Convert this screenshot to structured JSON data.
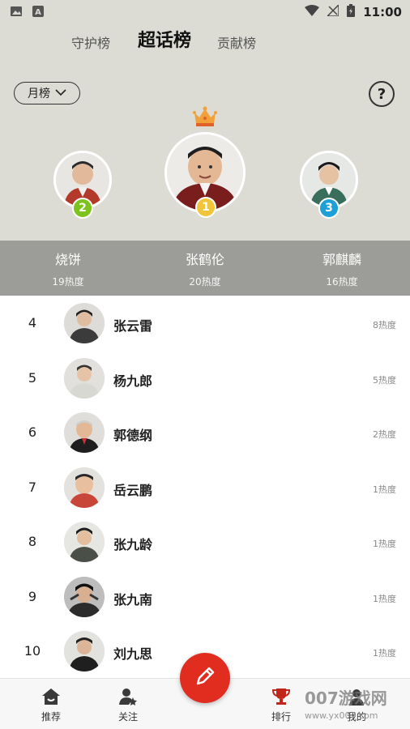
{
  "status_bar": {
    "time": "11:00"
  },
  "tabs": [
    {
      "label": "守护榜"
    },
    {
      "label": "超话榜"
    },
    {
      "label": "贡献榜"
    }
  ],
  "filter": {
    "label": "月榜"
  },
  "help": {
    "label": "?"
  },
  "podium": [
    {
      "rank": "2",
      "name": "烧饼",
      "heat": "19热度"
    },
    {
      "rank": "1",
      "name": "张鹤伦",
      "heat": "20热度"
    },
    {
      "rank": "3",
      "name": "郭麒麟",
      "heat": "16热度"
    }
  ],
  "ranking": [
    {
      "rank": "4",
      "name": "张云雷",
      "heat": "8热度"
    },
    {
      "rank": "5",
      "name": "杨九郎",
      "heat": "5热度"
    },
    {
      "rank": "6",
      "name": "郭德纲",
      "heat": "2热度"
    },
    {
      "rank": "7",
      "name": "岳云鹏",
      "heat": "1热度"
    },
    {
      "rank": "8",
      "name": "张九龄",
      "heat": "1热度"
    },
    {
      "rank": "9",
      "name": "张九南",
      "heat": "1热度"
    },
    {
      "rank": "10",
      "name": "刘九思",
      "heat": "1热度"
    }
  ],
  "bottom_nav": [
    {
      "label": "推荐",
      "icon": "home-icon"
    },
    {
      "label": "关注",
      "icon": "user-star-icon"
    },
    {
      "label": "",
      "icon": "pencil-icon"
    },
    {
      "label": "排行",
      "icon": "trophy-icon"
    },
    {
      "label": "我的",
      "icon": "profile-icon"
    }
  ],
  "watermark": {
    "line1": "007游戏网",
    "line2": "www.yx007.com"
  },
  "colors": {
    "header_bg": "#dcdcd5",
    "podium_band": "#9c9c98",
    "fab": "#e02d1f",
    "rank1": "#f0c53c",
    "rank2": "#7cc31e",
    "rank3": "#1da0d8"
  }
}
